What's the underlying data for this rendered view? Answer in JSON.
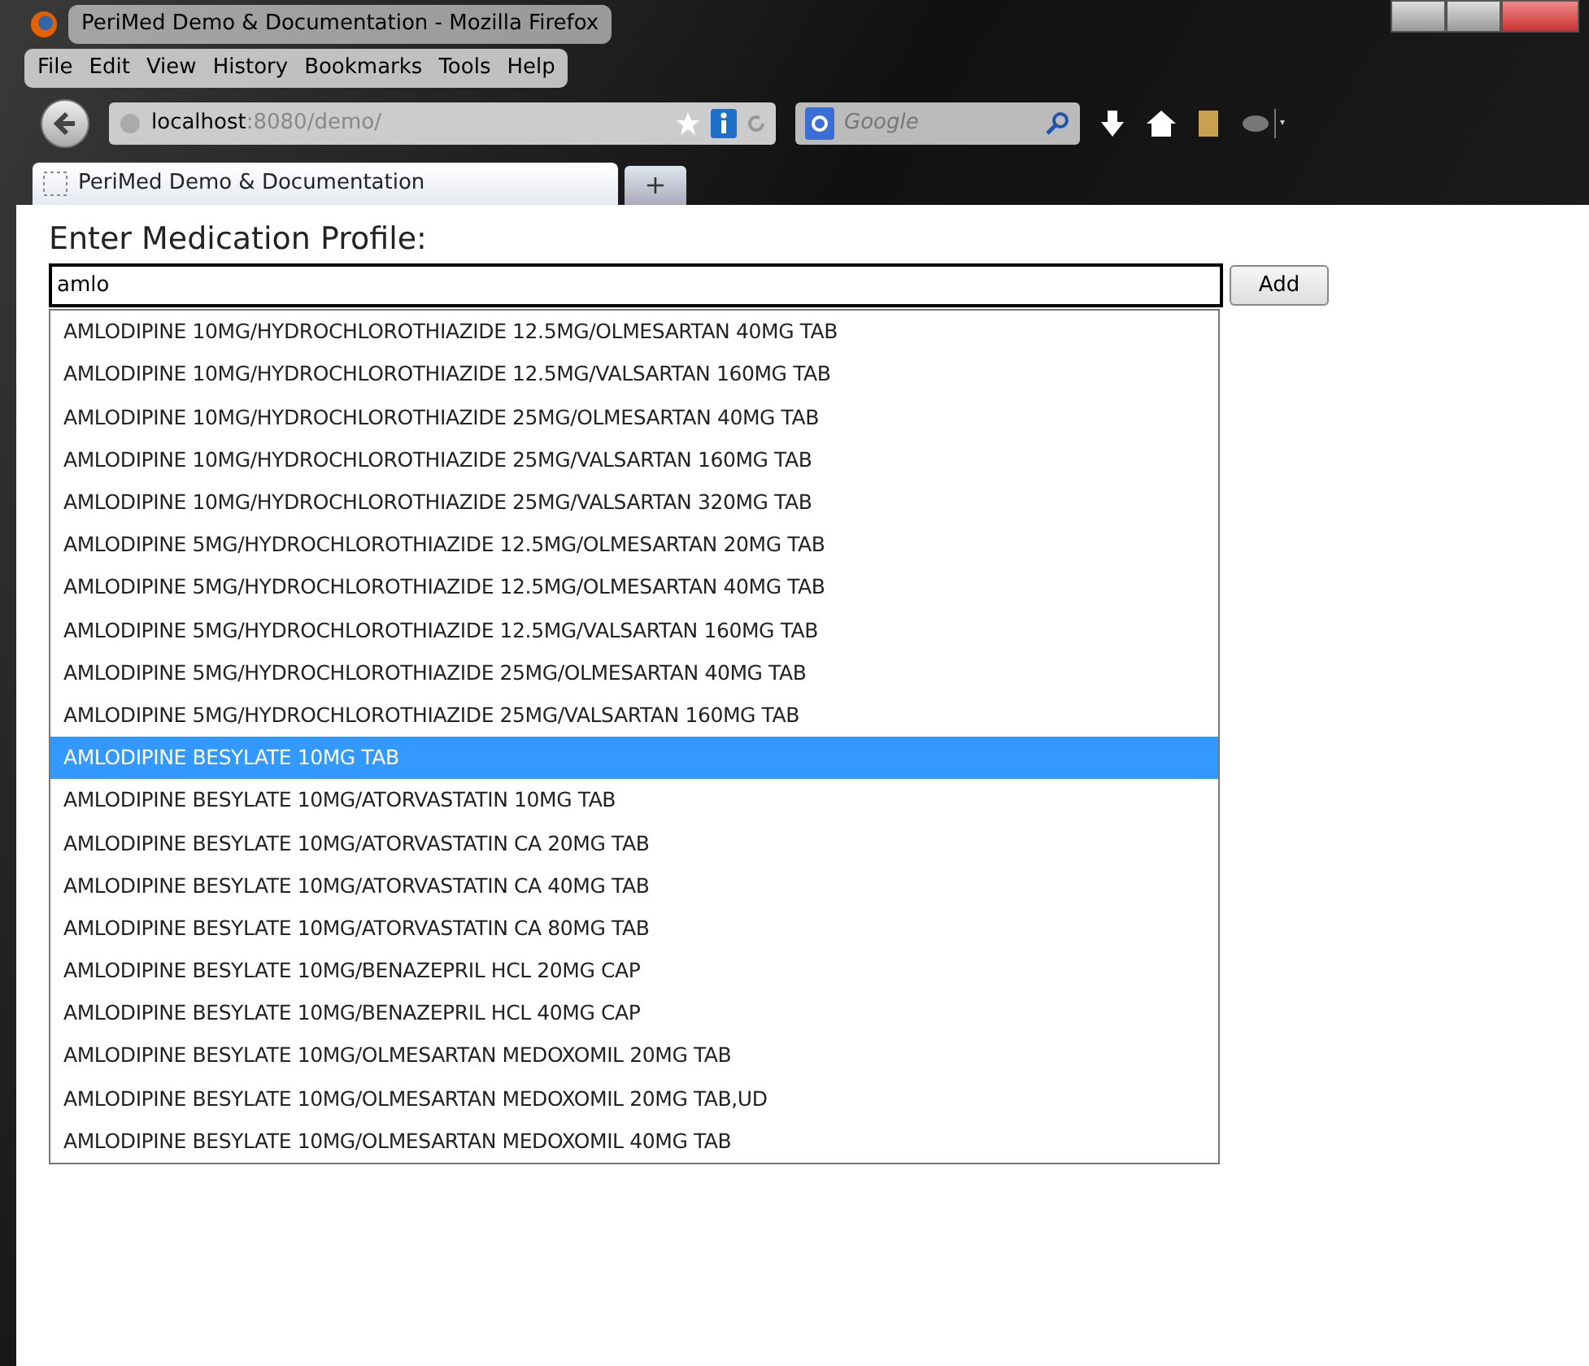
{
  "window": {
    "title": "PeriMed Demo & Documentation - Mozilla Firefox"
  },
  "menu": [
    "File",
    "Edit",
    "View",
    "History",
    "Bookmarks",
    "Tools",
    "Help"
  ],
  "address": {
    "host": "localhost",
    "path": ":8080/demo/"
  },
  "search": {
    "placeholder": "Google"
  },
  "tabs": [
    {
      "label": "PeriMed Demo & Documentation",
      "selected": true
    }
  ],
  "new_tab": "+",
  "page": {
    "heading": "Enter Medication Profile:",
    "input": "amlo",
    "add_button": "Add",
    "suggestions": [
      {
        "text": "AMLODIPINE 10MG/HYDROCHLOROTHIAZIDE 12.5MG/OLMESARTAN 40MG TAB",
        "selected": false
      },
      {
        "text": "AMLODIPINE 10MG/HYDROCHLOROTHIAZIDE 12.5MG/VALSARTAN 160MG TAB",
        "selected": false
      },
      {
        "text": "AMLODIPINE 10MG/HYDROCHLOROTHIAZIDE 25MG/OLMESARTAN 40MG TAB",
        "selected": false
      },
      {
        "text": "AMLODIPINE 10MG/HYDROCHLOROTHIAZIDE 25MG/VALSARTAN 160MG TAB",
        "selected": false
      },
      {
        "text": "AMLODIPINE 10MG/HYDROCHLOROTHIAZIDE 25MG/VALSARTAN 320MG TAB",
        "selected": false
      },
      {
        "text": "AMLODIPINE 5MG/HYDROCHLOROTHIAZIDE 12.5MG/OLMESARTAN 20MG TAB",
        "selected": false
      },
      {
        "text": "AMLODIPINE 5MG/HYDROCHLOROTHIAZIDE 12.5MG/OLMESARTAN 40MG TAB",
        "selected": false
      },
      {
        "text": "AMLODIPINE 5MG/HYDROCHLOROTHIAZIDE 12.5MG/VALSARTAN 160MG TAB",
        "selected": false
      },
      {
        "text": "AMLODIPINE 5MG/HYDROCHLOROTHIAZIDE 25MG/OLMESARTAN 40MG TAB",
        "selected": false
      },
      {
        "text": "AMLODIPINE 5MG/HYDROCHLOROTHIAZIDE 25MG/VALSARTAN 160MG TAB",
        "selected": false
      },
      {
        "text": "AMLODIPINE BESYLATE 10MG TAB",
        "selected": true
      },
      {
        "text": "AMLODIPINE BESYLATE 10MG/ATORVASTATIN 10MG TAB",
        "selected": false
      },
      {
        "text": "AMLODIPINE BESYLATE 10MG/ATORVASTATIN CA 20MG TAB",
        "selected": false
      },
      {
        "text": "AMLODIPINE BESYLATE 10MG/ATORVASTATIN CA 40MG TAB",
        "selected": false
      },
      {
        "text": "AMLODIPINE BESYLATE 10MG/ATORVASTATIN CA 80MG TAB",
        "selected": false
      },
      {
        "text": "AMLODIPINE BESYLATE 10MG/BENAZEPRIL HCL 20MG CAP",
        "selected": false
      },
      {
        "text": "AMLODIPINE BESYLATE 10MG/BENAZEPRIL HCL 40MG CAP",
        "selected": false
      },
      {
        "text": "AMLODIPINE BESYLATE 10MG/OLMESARTAN MEDOXOMIL 20MG TAB",
        "selected": false
      },
      {
        "text": "AMLODIPINE BESYLATE 10MG/OLMESARTAN MEDOXOMIL 20MG TAB,UD",
        "selected": false
      },
      {
        "text": "AMLODIPINE BESYLATE 10MG/OLMESARTAN MEDOXOMIL 40MG TAB",
        "selected": false
      }
    ]
  }
}
